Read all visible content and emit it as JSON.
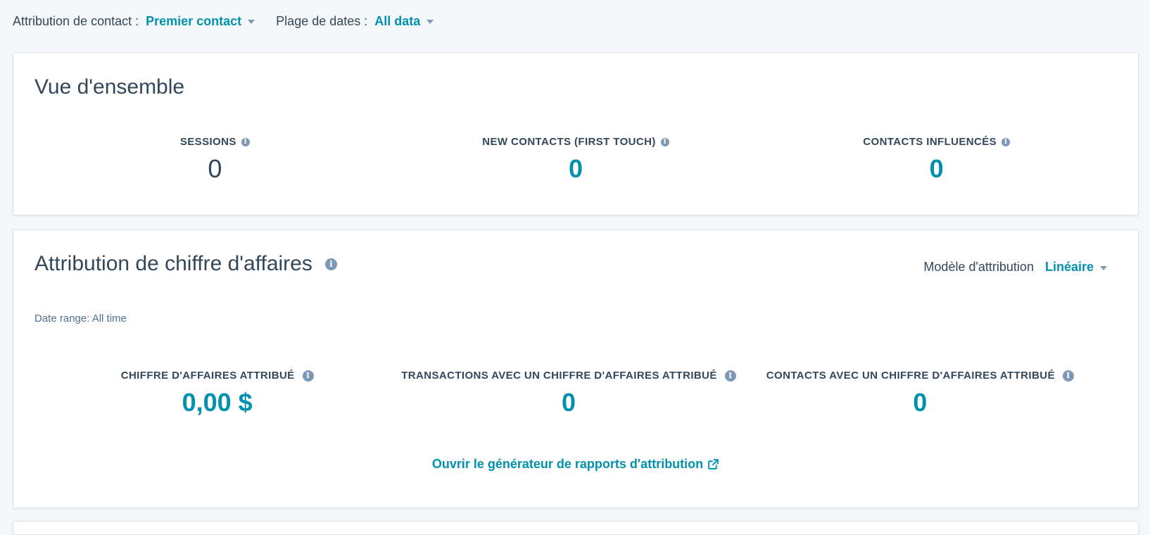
{
  "filters": {
    "attribution": {
      "label": "Attribution de contact :",
      "value": "Premier contact"
    },
    "date_range": {
      "label": "Plage de dates :",
      "value": "All data"
    }
  },
  "overview": {
    "title": "Vue d'ensemble",
    "kpis": [
      {
        "label": "SESSIONS",
        "value": "0",
        "style": "plain"
      },
      {
        "label": "NEW CONTACTS (FIRST TOUCH)",
        "value": "0",
        "style": "accent"
      },
      {
        "label": "CONTACTS INFLUENCÉS",
        "value": "0",
        "style": "accent"
      }
    ]
  },
  "revenue": {
    "title": "Attribution de chiffre d'affaires",
    "model_label": "Modèle d'attribution",
    "model_value": "Linéaire",
    "date_range_text": "Date range: All time",
    "kpis": [
      {
        "label": "CHIFFRE D'AFFAIRES ATTRIBUÉ",
        "value": "0,00 $"
      },
      {
        "label": "TRANSACTIONS AVEC UN CHIFFRE D'AFFAIRES ATTRIBUÉ",
        "value": "0"
      },
      {
        "label": "CONTACTS AVEC UN CHIFFRE D'AFFAIRES ATTRIBUÉ",
        "value": "0"
      }
    ],
    "report_link": "Ouvrir le générateur de rapports d'attribution"
  },
  "icons": {
    "info": "info-icon",
    "caret": "caret-down-icon",
    "external": "external-link-icon"
  },
  "colors": {
    "accent": "#0091ae",
    "text": "#33475b",
    "icon": "#7c98b6",
    "background": "#f5f8fa",
    "card": "#ffffff"
  }
}
